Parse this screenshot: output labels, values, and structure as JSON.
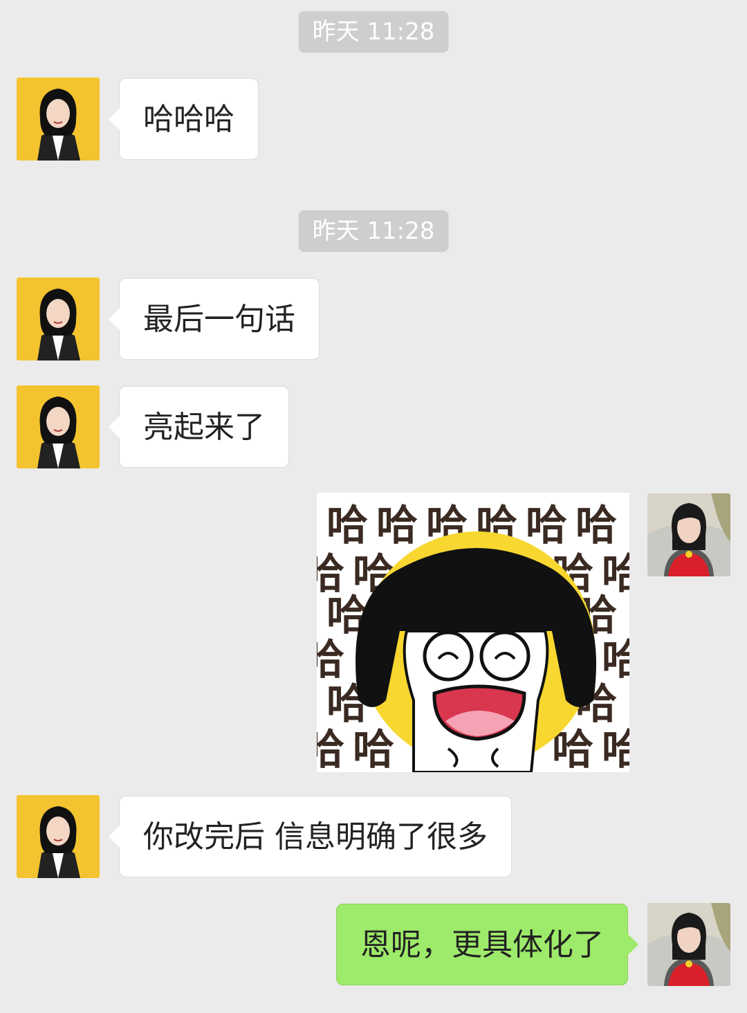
{
  "timestamps": [
    "昨天 11:28",
    "昨天 11:28"
  ],
  "messages": [
    {
      "side": "incoming",
      "text": "哈哈哈"
    },
    {
      "side": "incoming",
      "text": "最后一句话"
    },
    {
      "side": "incoming",
      "text": "亮起来了"
    },
    {
      "side": "outgoing",
      "type": "sticker",
      "sticker_text": "哈"
    },
    {
      "side": "incoming",
      "text": "你改完后 信息明确了很多"
    },
    {
      "side": "outgoing",
      "text": "恩呢，更具体化了"
    }
  ],
  "colors": {
    "background": "#ebebeb",
    "incoming_bubble": "#ffffff",
    "outgoing_bubble": "#9eea6a",
    "timestamp_bg": "#cecece",
    "contact_avatar_bg": "#f4c430"
  },
  "icons": [
    "contact-avatar",
    "my-avatar",
    "laughing-girl-sticker"
  ]
}
